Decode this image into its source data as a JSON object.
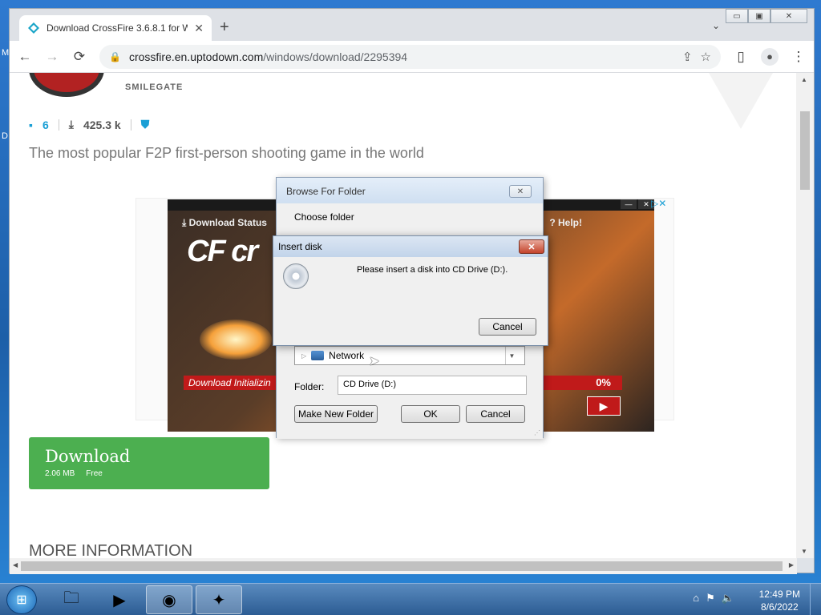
{
  "desktop": {
    "letter1": "M",
    "letter2": "D"
  },
  "browser": {
    "tab_title": "Download CrossFire 3.6.8.1 for W",
    "tab_close": "✕",
    "newtab": "+",
    "tab_search": "⌄",
    "winbtns": {
      "min": "▭",
      "max": "▣",
      "close": "✕"
    },
    "url_host": "crossfire.en.uptodown.com",
    "url_path": "/windows/download/2295394",
    "icons": {
      "back": "←",
      "forward": "→",
      "reload": "⟳",
      "lock": "🔒",
      "share": "⇪",
      "star": "☆",
      "sidepanel": "▯",
      "menu": "⋮",
      "profile": "●"
    }
  },
  "page": {
    "publisher": "SMILEGATE",
    "comments_count": "6",
    "downloads": "425.3 k",
    "tagline": "The most popular F2P first-person shooting game in the world",
    "ad": {
      "status": "⤓ Download Status",
      "help": "? Help!",
      "logo": "CF cr",
      "bar_text": "Download Initializin",
      "percent": "0%",
      "play": "▶",
      "ctrl_min": "—",
      "ctrl_close": "✕",
      "adx": "▷✕"
    },
    "download_btn": {
      "title": "Download",
      "size": "2.06 MB",
      "license": "Free"
    },
    "more_info": "MORE INFORMATION"
  },
  "browse_dialog": {
    "title": "Browse For Folder",
    "close": "✕",
    "choose": "Choose folder",
    "tree_item": "Network",
    "folder_label": "Folder:",
    "folder_value": "CD Drive (D:)",
    "make_new": "Make New Folder",
    "ok": "OK",
    "cancel": "Cancel"
  },
  "insert_dialog": {
    "title": "Insert disk",
    "close": "✕",
    "message": "Please insert a disk into CD Drive (D:).",
    "cancel": "Cancel"
  },
  "taskbar": {
    "time": "12:49 PM",
    "date": "8/6/2022"
  }
}
